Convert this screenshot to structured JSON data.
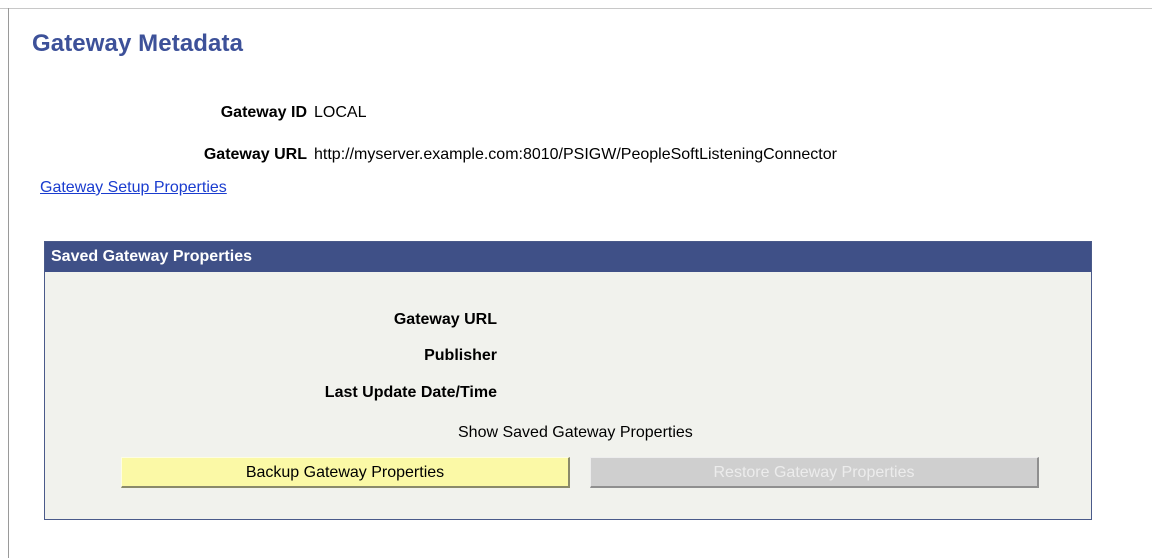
{
  "page": {
    "title": "Gateway Metadata"
  },
  "fields": {
    "gateway_id_label": "Gateway ID",
    "gateway_id_value": "LOCAL",
    "gateway_url_label": "Gateway URL",
    "gateway_url_value": "http://myserver.example.com:8010/PSIGW/PeopleSoftListeningConnector"
  },
  "links": {
    "gateway_setup": "Gateway Setup Properties"
  },
  "saved_group": {
    "header": "Saved Gateway Properties",
    "gateway_url_label": "Gateway URL",
    "publisher_label": "Publisher",
    "last_update_label": "Last Update Date/Time",
    "show_saved_text": "Show Saved Gateway Properties",
    "backup_button": "Backup Gateway Properties",
    "restore_button": "Restore Gateway Properties"
  },
  "colors": {
    "title": "#3d5199",
    "header_bg": "#3f5087",
    "group_bg": "#f1f2ed",
    "link": "#1a3ccf",
    "backup_button_bg": "#fbf9a6",
    "restore_button_bg": "#cfcfcf"
  }
}
